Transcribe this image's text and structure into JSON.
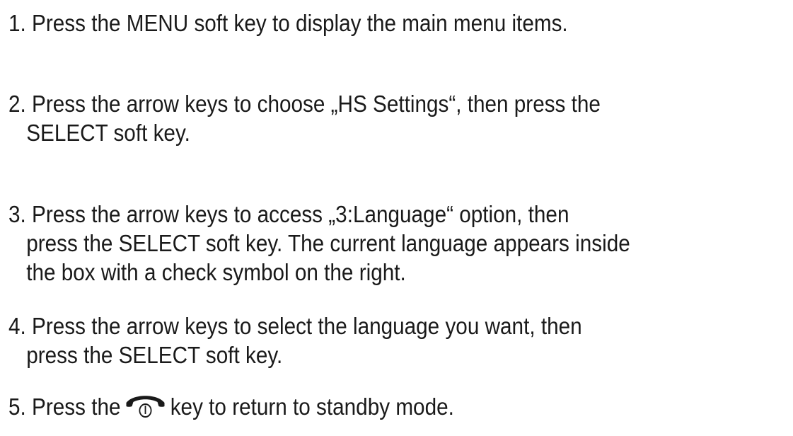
{
  "steps": [
    {
      "number": "1.",
      "lines": [
        "Press the MENU soft key to display the main menu items."
      ]
    },
    {
      "number": "2.",
      "lines": [
        "Press the arrow keys to choose „HS Settings“, then press the",
        "SELECT soft key."
      ]
    },
    {
      "number": "3.",
      "lines": [
        "Press the arrow keys to access „3:Language“ option, then",
        "press the SELECT soft key. The current language appears inside",
        "the box with a check symbol on the right."
      ]
    },
    {
      "number": "4.",
      "lines": [
        "Press the arrow keys to select the language you want, then",
        "press the SELECT soft key."
      ]
    },
    {
      "number": "5.",
      "before_icon": "Press the",
      "icon": "end-call-key-icon",
      "after_icon": "key to return to standby mode."
    }
  ]
}
